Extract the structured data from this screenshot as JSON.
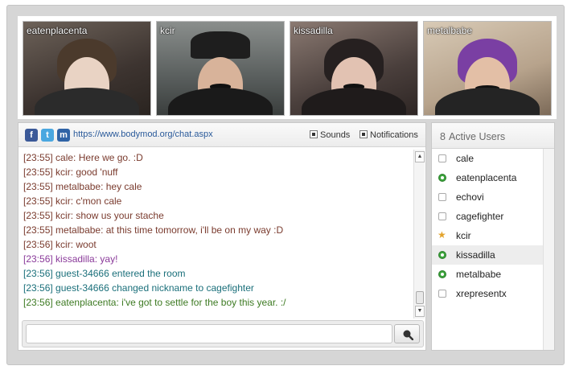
{
  "video_feeds": [
    {
      "username": "eatenplacenta"
    },
    {
      "username": "kcir"
    },
    {
      "username": "kissadilla"
    },
    {
      "username": "metalbabe"
    }
  ],
  "chat": {
    "url": "https://www.bodymod.org/chat.aspx",
    "sounds_label": "Sounds",
    "notifications_label": "Notifications",
    "social_icons": [
      "facebook-icon",
      "twitter-icon",
      "myspace-icon"
    ],
    "messages": [
      {
        "time": "[23:55]",
        "text": "cale: Here we go. :D",
        "style": "default"
      },
      {
        "time": "[23:55]",
        "text": "kcir: good 'nuff",
        "style": "default"
      },
      {
        "time": "[23:55]",
        "text": "metalbabe: hey cale",
        "style": "default"
      },
      {
        "time": "[23:55]",
        "text": "kcir: c'mon cale",
        "style": "default"
      },
      {
        "time": "[23:55]",
        "text": "kcir: show us your stache",
        "style": "default"
      },
      {
        "time": "[23:55]",
        "text": "metalbabe: at this time tomorrow, i'll be on my way :D",
        "style": "default"
      },
      {
        "time": "[23:56]",
        "text": "kcir: woot",
        "style": "default"
      },
      {
        "time": "[23:56]",
        "text": "kissadilla: yay!",
        "style": "purple"
      },
      {
        "time": "[23:56]",
        "text": "guest-34666 entered the room",
        "style": "system"
      },
      {
        "time": "[23:56]",
        "text": "guest-34666 changed nickname to cagefighter",
        "style": "system"
      },
      {
        "time": "[23:56]",
        "text": "eatenplacenta: i've got to settle for the boy this year. :/",
        "style": "green"
      }
    ],
    "input_value": "",
    "input_placeholder": ""
  },
  "users": {
    "count": "8",
    "title": "Active Users",
    "list": [
      {
        "name": "cale",
        "status": "idle"
      },
      {
        "name": "eatenplacenta",
        "status": "cam"
      },
      {
        "name": "echovi",
        "status": "idle"
      },
      {
        "name": "cagefighter",
        "status": "idle"
      },
      {
        "name": "kcir",
        "status": "star"
      },
      {
        "name": "kissadilla",
        "status": "cam",
        "highlight": true
      },
      {
        "name": "metalbabe",
        "status": "cam"
      },
      {
        "name": "xrepresentx",
        "status": "idle"
      }
    ]
  },
  "colors": {
    "message_default": "#7a3b2e",
    "message_purple": "#8a3a9a",
    "message_system": "#1a6f7a",
    "message_green": "#3d7a22",
    "status_cam": "#3ba33b",
    "status_star": "#e3a32b"
  }
}
